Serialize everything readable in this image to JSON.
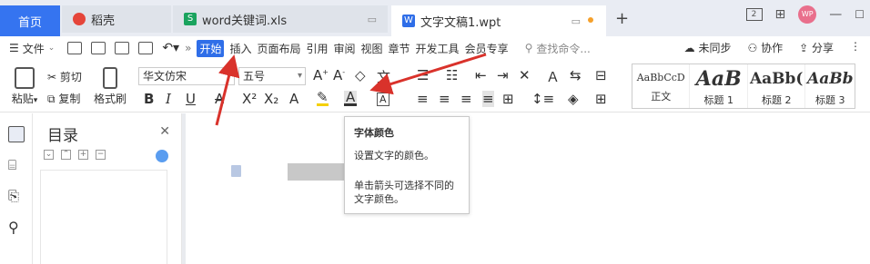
{
  "tabs": {
    "home": "首页",
    "daoke": "稻壳",
    "xls": "word关键词.xls",
    "wpt": "文字文稿1.wpt",
    "plus": "+"
  },
  "window": {
    "avatar": "WP",
    "layout_badge": "2"
  },
  "menu": {
    "file": "文件",
    "items": [
      "开始",
      "插入",
      "页面布局",
      "引用",
      "审阅",
      "视图",
      "章节",
      "开发工具",
      "会员专享"
    ],
    "search": "查找命令...",
    "unsync": "未同步",
    "collab": "协作",
    "share": "分享"
  },
  "ribbon": {
    "paste": "粘贴",
    "cut": "剪切",
    "copy": "复制",
    "format_painter": "格式刷",
    "font_name": "华文仿宋",
    "font_size": "五号",
    "styles": [
      {
        "sample": "AaBbCcD",
        "label": "正文"
      },
      {
        "sample": "AaB",
        "label": "标题 1"
      },
      {
        "sample": "AaBb(",
        "label": "标题 2"
      },
      {
        "sample": "AaBb",
        "label": "标题 3"
      }
    ]
  },
  "toc": {
    "title": "目录",
    "close": "✕"
  },
  "tooltip": {
    "title": "字体颜色",
    "desc": "设置文字的颜色。",
    "hint": "单击箭头可选择不同的文字颜色。"
  },
  "colors": {
    "accent": "#2f6ee8",
    "home_tab": "#3574f0",
    "arrow": "#d9322b"
  }
}
